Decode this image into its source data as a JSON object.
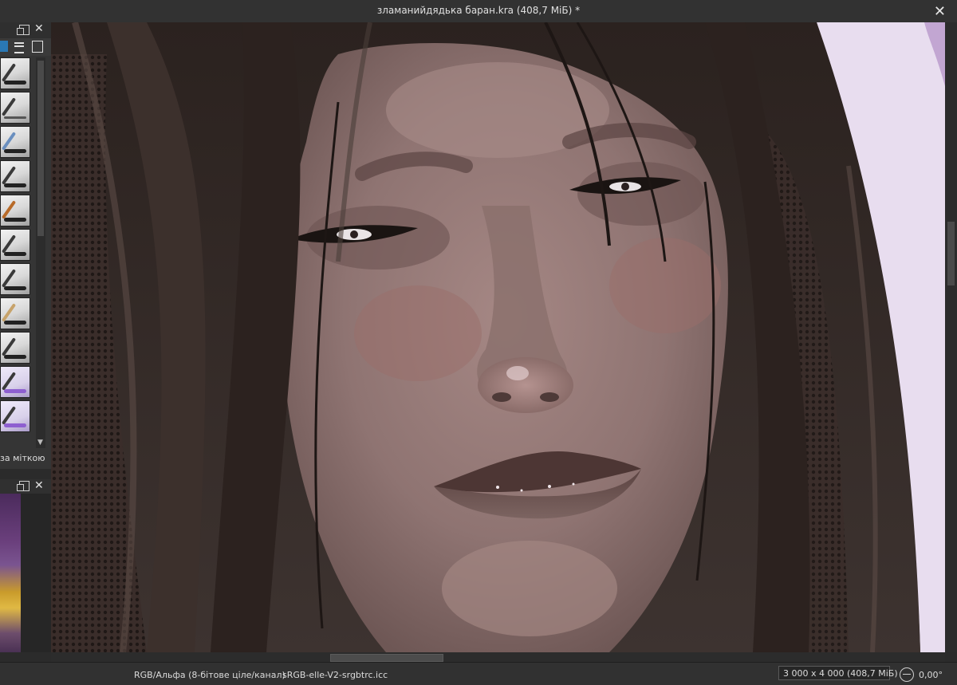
{
  "window": {
    "title": "зламанийдядька баран.kra (408,7 МіБ) *",
    "close_icon": "close-icon"
  },
  "brush_docker": {
    "filter_label": "за міткою",
    "icons": [
      "float-icon",
      "close-icon",
      "menu-icon",
      "lock-icon"
    ],
    "presets_count": 11
  },
  "overview_docker": {
    "icons": [
      "float-icon",
      "close-icon"
    ]
  },
  "status": {
    "color_space": "RGB/Альфа (8-бітове ціле/канал)",
    "profile": "sRGB-elle-V2-srgbtrc.icc",
    "dimensions": "3 000 x 4 000 (408,7 МіБ)",
    "rotation": "0,00°"
  },
  "colors": {
    "ui_dark": "#2b2b2b",
    "canvas_bg": "#e7dcee",
    "hair": "#2e2420",
    "skin": "#9a7d7a",
    "accent": "#2a78b4"
  }
}
